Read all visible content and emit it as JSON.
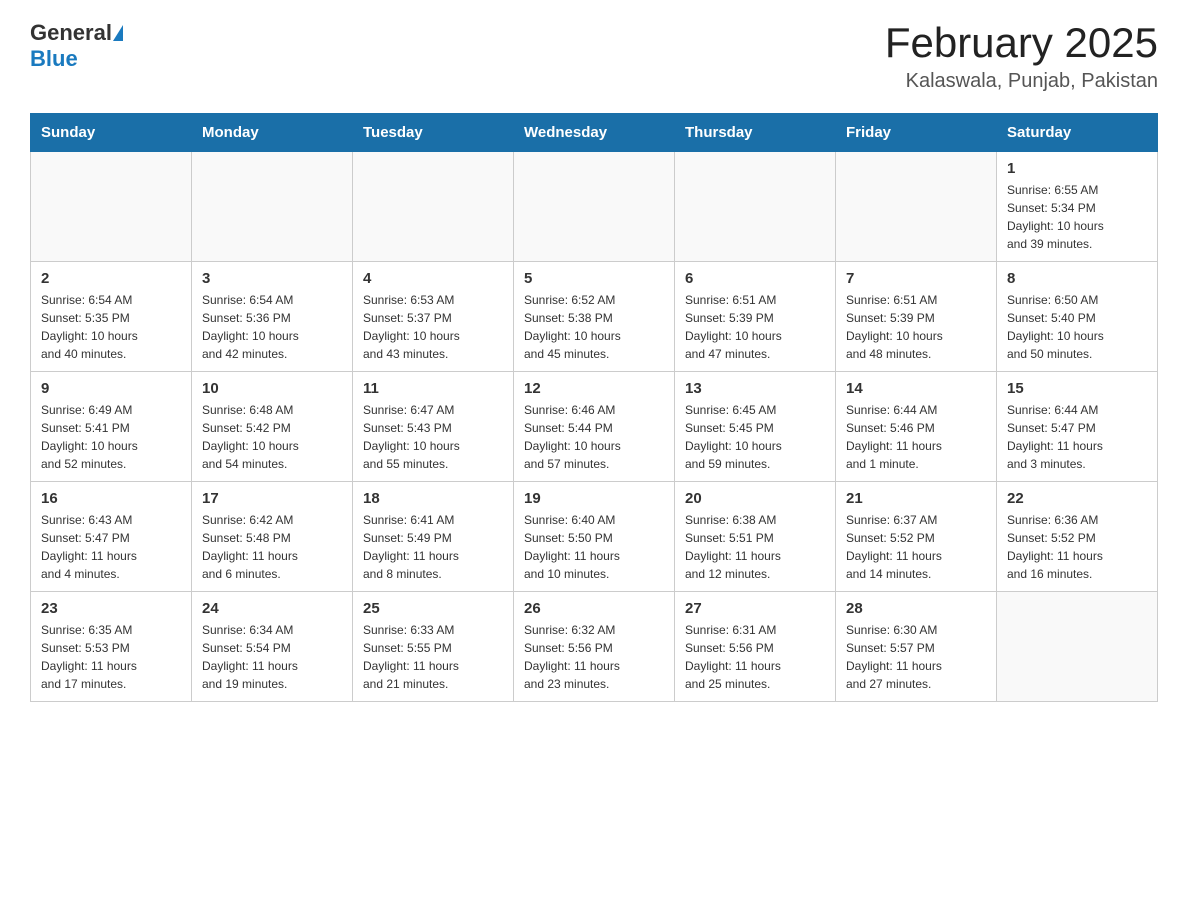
{
  "header": {
    "logo": {
      "general": "General",
      "blue": "Blue"
    },
    "title": "February 2025",
    "subtitle": "Kalaswala, Punjab, Pakistan"
  },
  "weekdays": [
    "Sunday",
    "Monday",
    "Tuesday",
    "Wednesday",
    "Thursday",
    "Friday",
    "Saturday"
  ],
  "weeks": [
    [
      {
        "day": "",
        "info": ""
      },
      {
        "day": "",
        "info": ""
      },
      {
        "day": "",
        "info": ""
      },
      {
        "day": "",
        "info": ""
      },
      {
        "day": "",
        "info": ""
      },
      {
        "day": "",
        "info": ""
      },
      {
        "day": "1",
        "info": "Sunrise: 6:55 AM\nSunset: 5:34 PM\nDaylight: 10 hours\nand 39 minutes."
      }
    ],
    [
      {
        "day": "2",
        "info": "Sunrise: 6:54 AM\nSunset: 5:35 PM\nDaylight: 10 hours\nand 40 minutes."
      },
      {
        "day": "3",
        "info": "Sunrise: 6:54 AM\nSunset: 5:36 PM\nDaylight: 10 hours\nand 42 minutes."
      },
      {
        "day": "4",
        "info": "Sunrise: 6:53 AM\nSunset: 5:37 PM\nDaylight: 10 hours\nand 43 minutes."
      },
      {
        "day": "5",
        "info": "Sunrise: 6:52 AM\nSunset: 5:38 PM\nDaylight: 10 hours\nand 45 minutes."
      },
      {
        "day": "6",
        "info": "Sunrise: 6:51 AM\nSunset: 5:39 PM\nDaylight: 10 hours\nand 47 minutes."
      },
      {
        "day": "7",
        "info": "Sunrise: 6:51 AM\nSunset: 5:39 PM\nDaylight: 10 hours\nand 48 minutes."
      },
      {
        "day": "8",
        "info": "Sunrise: 6:50 AM\nSunset: 5:40 PM\nDaylight: 10 hours\nand 50 minutes."
      }
    ],
    [
      {
        "day": "9",
        "info": "Sunrise: 6:49 AM\nSunset: 5:41 PM\nDaylight: 10 hours\nand 52 minutes."
      },
      {
        "day": "10",
        "info": "Sunrise: 6:48 AM\nSunset: 5:42 PM\nDaylight: 10 hours\nand 54 minutes."
      },
      {
        "day": "11",
        "info": "Sunrise: 6:47 AM\nSunset: 5:43 PM\nDaylight: 10 hours\nand 55 minutes."
      },
      {
        "day": "12",
        "info": "Sunrise: 6:46 AM\nSunset: 5:44 PM\nDaylight: 10 hours\nand 57 minutes."
      },
      {
        "day": "13",
        "info": "Sunrise: 6:45 AM\nSunset: 5:45 PM\nDaylight: 10 hours\nand 59 minutes."
      },
      {
        "day": "14",
        "info": "Sunrise: 6:44 AM\nSunset: 5:46 PM\nDaylight: 11 hours\nand 1 minute."
      },
      {
        "day": "15",
        "info": "Sunrise: 6:44 AM\nSunset: 5:47 PM\nDaylight: 11 hours\nand 3 minutes."
      }
    ],
    [
      {
        "day": "16",
        "info": "Sunrise: 6:43 AM\nSunset: 5:47 PM\nDaylight: 11 hours\nand 4 minutes."
      },
      {
        "day": "17",
        "info": "Sunrise: 6:42 AM\nSunset: 5:48 PM\nDaylight: 11 hours\nand 6 minutes."
      },
      {
        "day": "18",
        "info": "Sunrise: 6:41 AM\nSunset: 5:49 PM\nDaylight: 11 hours\nand 8 minutes."
      },
      {
        "day": "19",
        "info": "Sunrise: 6:40 AM\nSunset: 5:50 PM\nDaylight: 11 hours\nand 10 minutes."
      },
      {
        "day": "20",
        "info": "Sunrise: 6:38 AM\nSunset: 5:51 PM\nDaylight: 11 hours\nand 12 minutes."
      },
      {
        "day": "21",
        "info": "Sunrise: 6:37 AM\nSunset: 5:52 PM\nDaylight: 11 hours\nand 14 minutes."
      },
      {
        "day": "22",
        "info": "Sunrise: 6:36 AM\nSunset: 5:52 PM\nDaylight: 11 hours\nand 16 minutes."
      }
    ],
    [
      {
        "day": "23",
        "info": "Sunrise: 6:35 AM\nSunset: 5:53 PM\nDaylight: 11 hours\nand 17 minutes."
      },
      {
        "day": "24",
        "info": "Sunrise: 6:34 AM\nSunset: 5:54 PM\nDaylight: 11 hours\nand 19 minutes."
      },
      {
        "day": "25",
        "info": "Sunrise: 6:33 AM\nSunset: 5:55 PM\nDaylight: 11 hours\nand 21 minutes."
      },
      {
        "day": "26",
        "info": "Sunrise: 6:32 AM\nSunset: 5:56 PM\nDaylight: 11 hours\nand 23 minutes."
      },
      {
        "day": "27",
        "info": "Sunrise: 6:31 AM\nSunset: 5:56 PM\nDaylight: 11 hours\nand 25 minutes."
      },
      {
        "day": "28",
        "info": "Sunrise: 6:30 AM\nSunset: 5:57 PM\nDaylight: 11 hours\nand 27 minutes."
      },
      {
        "day": "",
        "info": ""
      }
    ]
  ]
}
